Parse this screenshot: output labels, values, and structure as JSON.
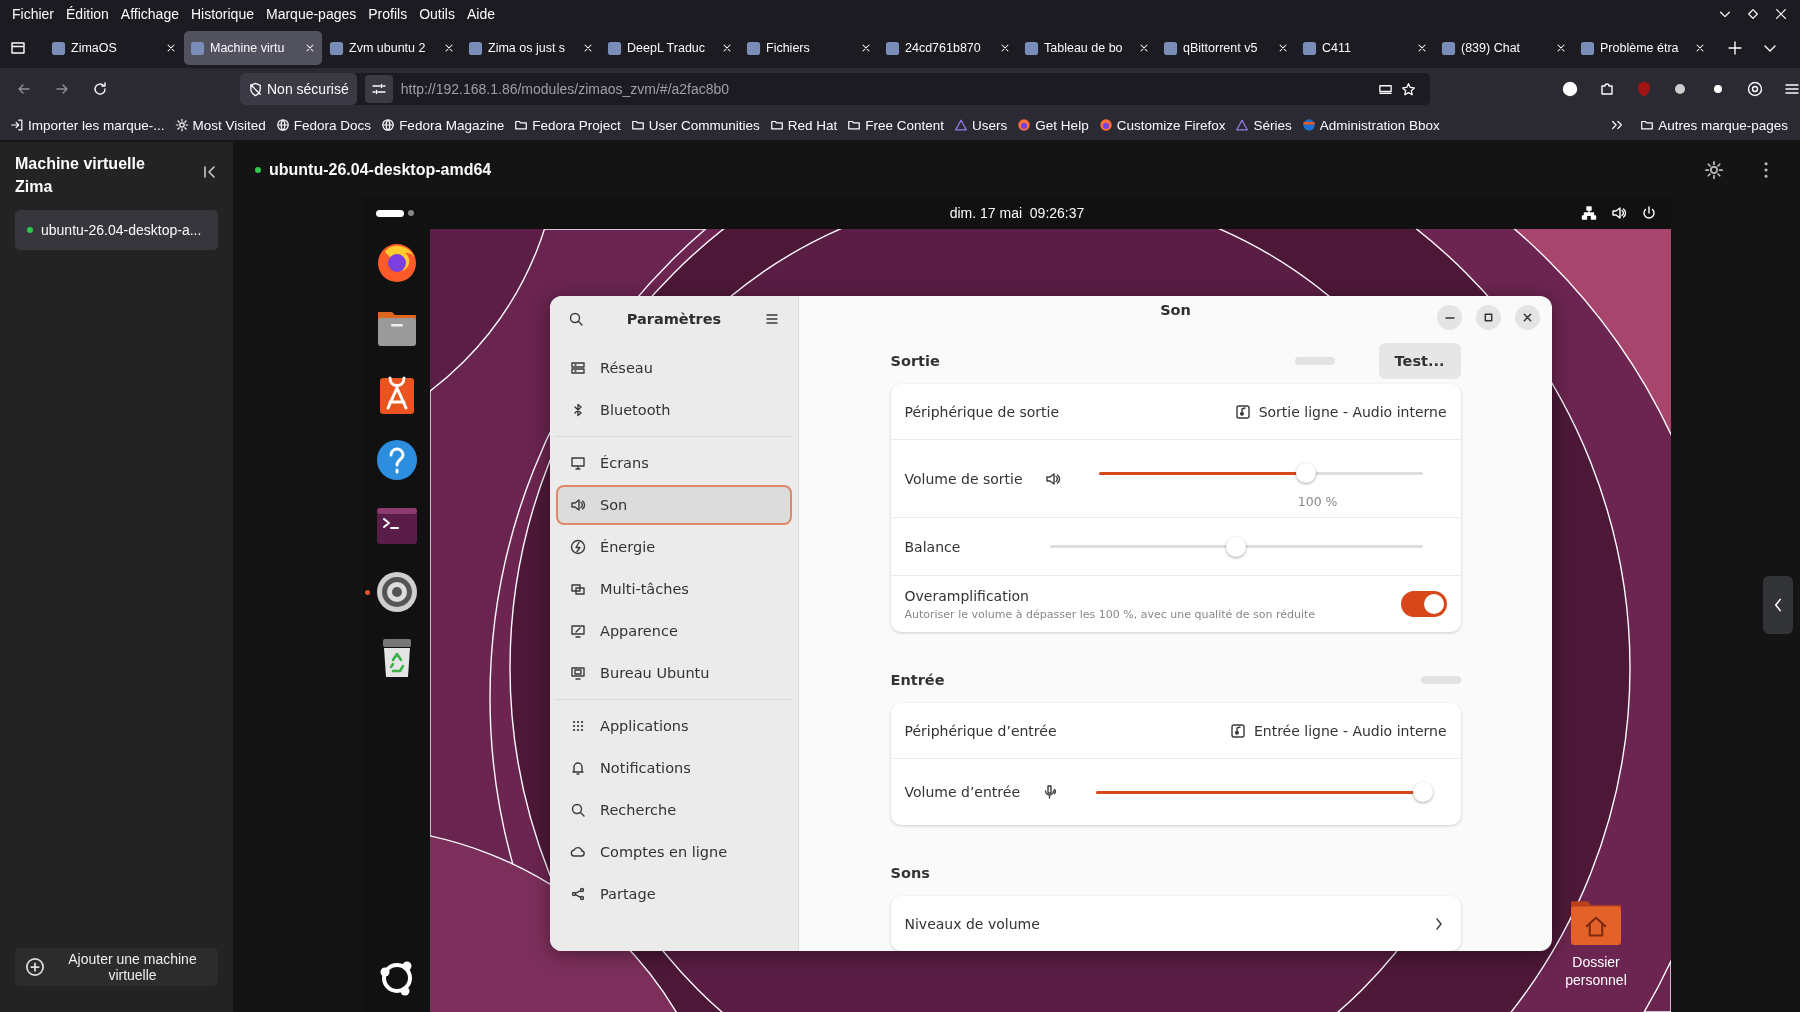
{
  "menu_bar": [
    "Fichier",
    "Édition",
    "Affichage",
    "Historique",
    "Marque-pages",
    "Profils",
    "Outils",
    "Aide"
  ],
  "tabs": [
    {
      "label": "ZimaOS",
      "selected": false
    },
    {
      "label": "Machine virtu",
      "selected": true
    },
    {
      "label": "Zvm ubuntu 2",
      "selected": false
    },
    {
      "label": "Zima os just s",
      "selected": false
    },
    {
      "label": "DeepL Traduc",
      "selected": false
    },
    {
      "label": "Fichiers",
      "selected": false
    },
    {
      "label": "24cd761b870",
      "selected": false
    },
    {
      "label": "Tableau de bo",
      "selected": false
    },
    {
      "label": "qBittorrent v5",
      "selected": false
    },
    {
      "label": "C411",
      "selected": false
    },
    {
      "label": "(839) Chat",
      "selected": false
    },
    {
      "label": "Problème étra",
      "selected": false
    }
  ],
  "nav": {
    "security": "Non sécurisé",
    "url": "http://192.168.1.86/modules/zimaos_zvm/#/a2fac8b0"
  },
  "bookmarks": [
    {
      "label": "Importer les marque-...",
      "kind": "import"
    },
    {
      "label": "Most Visited",
      "kind": "gear"
    },
    {
      "label": "Fedora Docs",
      "kind": "globe"
    },
    {
      "label": "Fedora Magazine",
      "kind": "globe"
    },
    {
      "label": "Fedora Project",
      "kind": "folder"
    },
    {
      "label": "User Communities",
      "kind": "folder"
    },
    {
      "label": "Red Hat",
      "kind": "folder"
    },
    {
      "label": "Free Content",
      "kind": "folder"
    },
    {
      "label": "Users",
      "kind": "triangle"
    },
    {
      "label": "Get Help",
      "kind": "fox"
    },
    {
      "label": "Customize Firefox",
      "kind": "fox"
    },
    {
      "label": "Séries",
      "kind": "triangle"
    },
    {
      "label": "Administration Bbox",
      "kind": "bbox"
    }
  ],
  "other_bookmarks": "Autres marque-pages",
  "zima_sidebar": {
    "title": "Machine virtuelle Zima",
    "machines": [
      {
        "name": "ubuntu-26.04-desktop-a...",
        "selected": true,
        "running": true
      }
    ],
    "add_button": "Ajouter une machine virtuelle"
  },
  "vm": {
    "name": "ubuntu-26.04-desktop-amd64",
    "running": true,
    "clock": "dim. 17 mai  09:26:37",
    "dock": [
      {
        "kind": "firefox",
        "running": false
      },
      {
        "kind": "files",
        "running": false
      },
      {
        "kind": "store",
        "running": false
      },
      {
        "kind": "help",
        "running": false
      },
      {
        "kind": "terminal",
        "running": false
      },
      {
        "kind": "settings",
        "running": true
      },
      {
        "kind": "trash",
        "running": false
      }
    ],
    "desktop_icons": [
      {
        "label": "Dossier personnel"
      }
    ]
  },
  "settings_window": {
    "sidebar_title": "Paramètres",
    "title": "Son",
    "nav_groups": [
      [
        {
          "label": "Réseau",
          "selected": false
        },
        {
          "label": "Bluetooth",
          "selected": false
        }
      ],
      [
        {
          "label": "Écrans",
          "selected": false
        },
        {
          "label": "Son",
          "selected": true
        },
        {
          "label": "Énergie",
          "selected": false
        },
        {
          "label": "Multi-tâches",
          "selected": false
        },
        {
          "label": "Apparence",
          "selected": false
        },
        {
          "label": "Bureau Ubuntu",
          "selected": false
        }
      ],
      [
        {
          "label": "Applications",
          "selected": false
        },
        {
          "label": "Notifications",
          "selected": false
        },
        {
          "label": "Recherche",
          "selected": false
        },
        {
          "label": "Comptes en ligne",
          "selected": false
        },
        {
          "label": "Partage",
          "selected": false
        }
      ]
    ],
    "sections": [
      {
        "title": "Sortie",
        "level": 0,
        "button": "Test...",
        "rows": [
          {
            "kind": "device",
            "label": "Périphérique de sortie",
            "value": "Sortie ligne - Audio interne"
          },
          {
            "kind": "slider",
            "label": "Volume de sortie",
            "level": 0.64,
            "reading": "100 %"
          },
          {
            "kind": "balance",
            "label": "Balance",
            "level": 0.5
          },
          {
            "kind": "switch",
            "label": "Overamplification",
            "description": "Autoriser le volume à dépasser les 100 %, avec une qualité de son réduite",
            "on": true
          }
        ]
      },
      {
        "title": "Entrée",
        "level": 0,
        "rows": [
          {
            "kind": "device",
            "label": "Périphérique d’entrée",
            "value": "Entrée ligne - Audio interne"
          },
          {
            "kind": "slider",
            "label": "Volume d’entrée",
            "level": 1
          }
        ]
      },
      {
        "title": "Sons",
        "rows": [
          {
            "kind": "link",
            "label": "Niveaux de volume"
          }
        ]
      }
    ]
  }
}
